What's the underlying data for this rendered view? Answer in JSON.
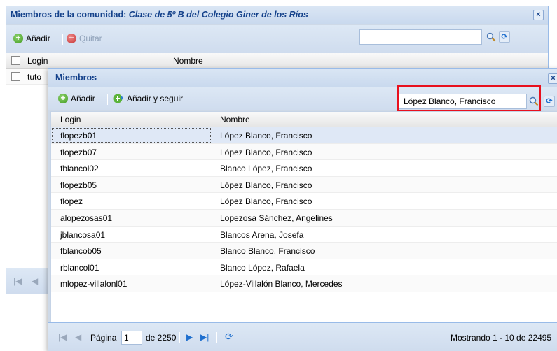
{
  "background_window": {
    "title_prefix": "Miembros de la comunidad: ",
    "title_italic": "Clase de 5º B del Colegio Giner de los Ríos",
    "close_label": "×",
    "toolbar": {
      "add_label": "Añadir",
      "remove_label": "Quitar"
    },
    "search": {
      "value": ""
    },
    "grid": {
      "columns": [
        "Login",
        "Nombre"
      ],
      "rows": [
        {
          "login": "tuto",
          "name": ""
        }
      ]
    }
  },
  "members_window": {
    "title": "Miembros",
    "close_label": "×",
    "toolbar": {
      "add_label": "Añadir",
      "add_and_continue_label": "Añadir y seguir"
    },
    "search": {
      "value": "López Blanco, Francisco"
    },
    "grid": {
      "columns": [
        "Login",
        "Nombre"
      ],
      "rows": [
        {
          "login": "flopezb01",
          "name": "López Blanco, Francisco"
        },
        {
          "login": "flopezb07",
          "name": "López Blanco, Francisco"
        },
        {
          "login": "fblancol02",
          "name": "Blanco López, Francisco"
        },
        {
          "login": "flopezb05",
          "name": "López Blanco, Francisco"
        },
        {
          "login": "flopez",
          "name": "López Blanco, Francisco"
        },
        {
          "login": "alopezosas01",
          "name": "Lopezosa Sánchez, Angelines"
        },
        {
          "login": "jblancosa01",
          "name": "Blancos Arena, Josefa"
        },
        {
          "login": "fblancob05",
          "name": "Blanco Blanco, Francisco"
        },
        {
          "login": "rblancol01",
          "name": "Blanco López, Rafaela"
        },
        {
          "login": "mlopez-villalonl01",
          "name": "López-Villalón Blanco, Mercedes"
        }
      ],
      "selected_index": 0
    },
    "pagination": {
      "page_label": "Página",
      "page_value": "1",
      "of_label": "de 2250",
      "status": "Mostrando 1 - 10 de 22495"
    }
  },
  "colors": {
    "title_text": "#15428b",
    "highlight_border": "#e8101e",
    "selected_row": "#dfe8f6",
    "panel_bg": "#ced9e7"
  }
}
